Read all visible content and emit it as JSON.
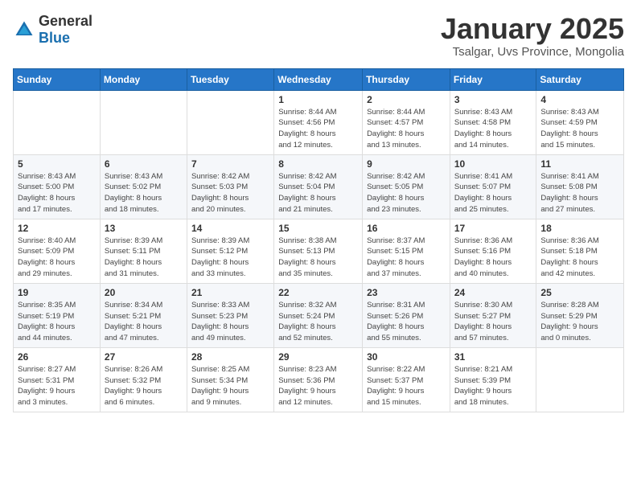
{
  "header": {
    "logo_general": "General",
    "logo_blue": "Blue",
    "month_title": "January 2025",
    "location": "Tsalgar, Uvs Province, Mongolia"
  },
  "weekdays": [
    "Sunday",
    "Monday",
    "Tuesday",
    "Wednesday",
    "Thursday",
    "Friday",
    "Saturday"
  ],
  "weeks": [
    [
      {
        "day": "",
        "info": ""
      },
      {
        "day": "",
        "info": ""
      },
      {
        "day": "",
        "info": ""
      },
      {
        "day": "1",
        "info": "Sunrise: 8:44 AM\nSunset: 4:56 PM\nDaylight: 8 hours\nand 12 minutes."
      },
      {
        "day": "2",
        "info": "Sunrise: 8:44 AM\nSunset: 4:57 PM\nDaylight: 8 hours\nand 13 minutes."
      },
      {
        "day": "3",
        "info": "Sunrise: 8:43 AM\nSunset: 4:58 PM\nDaylight: 8 hours\nand 14 minutes."
      },
      {
        "day": "4",
        "info": "Sunrise: 8:43 AM\nSunset: 4:59 PM\nDaylight: 8 hours\nand 15 minutes."
      }
    ],
    [
      {
        "day": "5",
        "info": "Sunrise: 8:43 AM\nSunset: 5:00 PM\nDaylight: 8 hours\nand 17 minutes."
      },
      {
        "day": "6",
        "info": "Sunrise: 8:43 AM\nSunset: 5:02 PM\nDaylight: 8 hours\nand 18 minutes."
      },
      {
        "day": "7",
        "info": "Sunrise: 8:42 AM\nSunset: 5:03 PM\nDaylight: 8 hours\nand 20 minutes."
      },
      {
        "day": "8",
        "info": "Sunrise: 8:42 AM\nSunset: 5:04 PM\nDaylight: 8 hours\nand 21 minutes."
      },
      {
        "day": "9",
        "info": "Sunrise: 8:42 AM\nSunset: 5:05 PM\nDaylight: 8 hours\nand 23 minutes."
      },
      {
        "day": "10",
        "info": "Sunrise: 8:41 AM\nSunset: 5:07 PM\nDaylight: 8 hours\nand 25 minutes."
      },
      {
        "day": "11",
        "info": "Sunrise: 8:41 AM\nSunset: 5:08 PM\nDaylight: 8 hours\nand 27 minutes."
      }
    ],
    [
      {
        "day": "12",
        "info": "Sunrise: 8:40 AM\nSunset: 5:09 PM\nDaylight: 8 hours\nand 29 minutes."
      },
      {
        "day": "13",
        "info": "Sunrise: 8:39 AM\nSunset: 5:11 PM\nDaylight: 8 hours\nand 31 minutes."
      },
      {
        "day": "14",
        "info": "Sunrise: 8:39 AM\nSunset: 5:12 PM\nDaylight: 8 hours\nand 33 minutes."
      },
      {
        "day": "15",
        "info": "Sunrise: 8:38 AM\nSunset: 5:13 PM\nDaylight: 8 hours\nand 35 minutes."
      },
      {
        "day": "16",
        "info": "Sunrise: 8:37 AM\nSunset: 5:15 PM\nDaylight: 8 hours\nand 37 minutes."
      },
      {
        "day": "17",
        "info": "Sunrise: 8:36 AM\nSunset: 5:16 PM\nDaylight: 8 hours\nand 40 minutes."
      },
      {
        "day": "18",
        "info": "Sunrise: 8:36 AM\nSunset: 5:18 PM\nDaylight: 8 hours\nand 42 minutes."
      }
    ],
    [
      {
        "day": "19",
        "info": "Sunrise: 8:35 AM\nSunset: 5:19 PM\nDaylight: 8 hours\nand 44 minutes."
      },
      {
        "day": "20",
        "info": "Sunrise: 8:34 AM\nSunset: 5:21 PM\nDaylight: 8 hours\nand 47 minutes."
      },
      {
        "day": "21",
        "info": "Sunrise: 8:33 AM\nSunset: 5:23 PM\nDaylight: 8 hours\nand 49 minutes."
      },
      {
        "day": "22",
        "info": "Sunrise: 8:32 AM\nSunset: 5:24 PM\nDaylight: 8 hours\nand 52 minutes."
      },
      {
        "day": "23",
        "info": "Sunrise: 8:31 AM\nSunset: 5:26 PM\nDaylight: 8 hours\nand 55 minutes."
      },
      {
        "day": "24",
        "info": "Sunrise: 8:30 AM\nSunset: 5:27 PM\nDaylight: 8 hours\nand 57 minutes."
      },
      {
        "day": "25",
        "info": "Sunrise: 8:28 AM\nSunset: 5:29 PM\nDaylight: 9 hours\nand 0 minutes."
      }
    ],
    [
      {
        "day": "26",
        "info": "Sunrise: 8:27 AM\nSunset: 5:31 PM\nDaylight: 9 hours\nand 3 minutes."
      },
      {
        "day": "27",
        "info": "Sunrise: 8:26 AM\nSunset: 5:32 PM\nDaylight: 9 hours\nand 6 minutes."
      },
      {
        "day": "28",
        "info": "Sunrise: 8:25 AM\nSunset: 5:34 PM\nDaylight: 9 hours\nand 9 minutes."
      },
      {
        "day": "29",
        "info": "Sunrise: 8:23 AM\nSunset: 5:36 PM\nDaylight: 9 hours\nand 12 minutes."
      },
      {
        "day": "30",
        "info": "Sunrise: 8:22 AM\nSunset: 5:37 PM\nDaylight: 9 hours\nand 15 minutes."
      },
      {
        "day": "31",
        "info": "Sunrise: 8:21 AM\nSunset: 5:39 PM\nDaylight: 9 hours\nand 18 minutes."
      },
      {
        "day": "",
        "info": ""
      }
    ]
  ]
}
